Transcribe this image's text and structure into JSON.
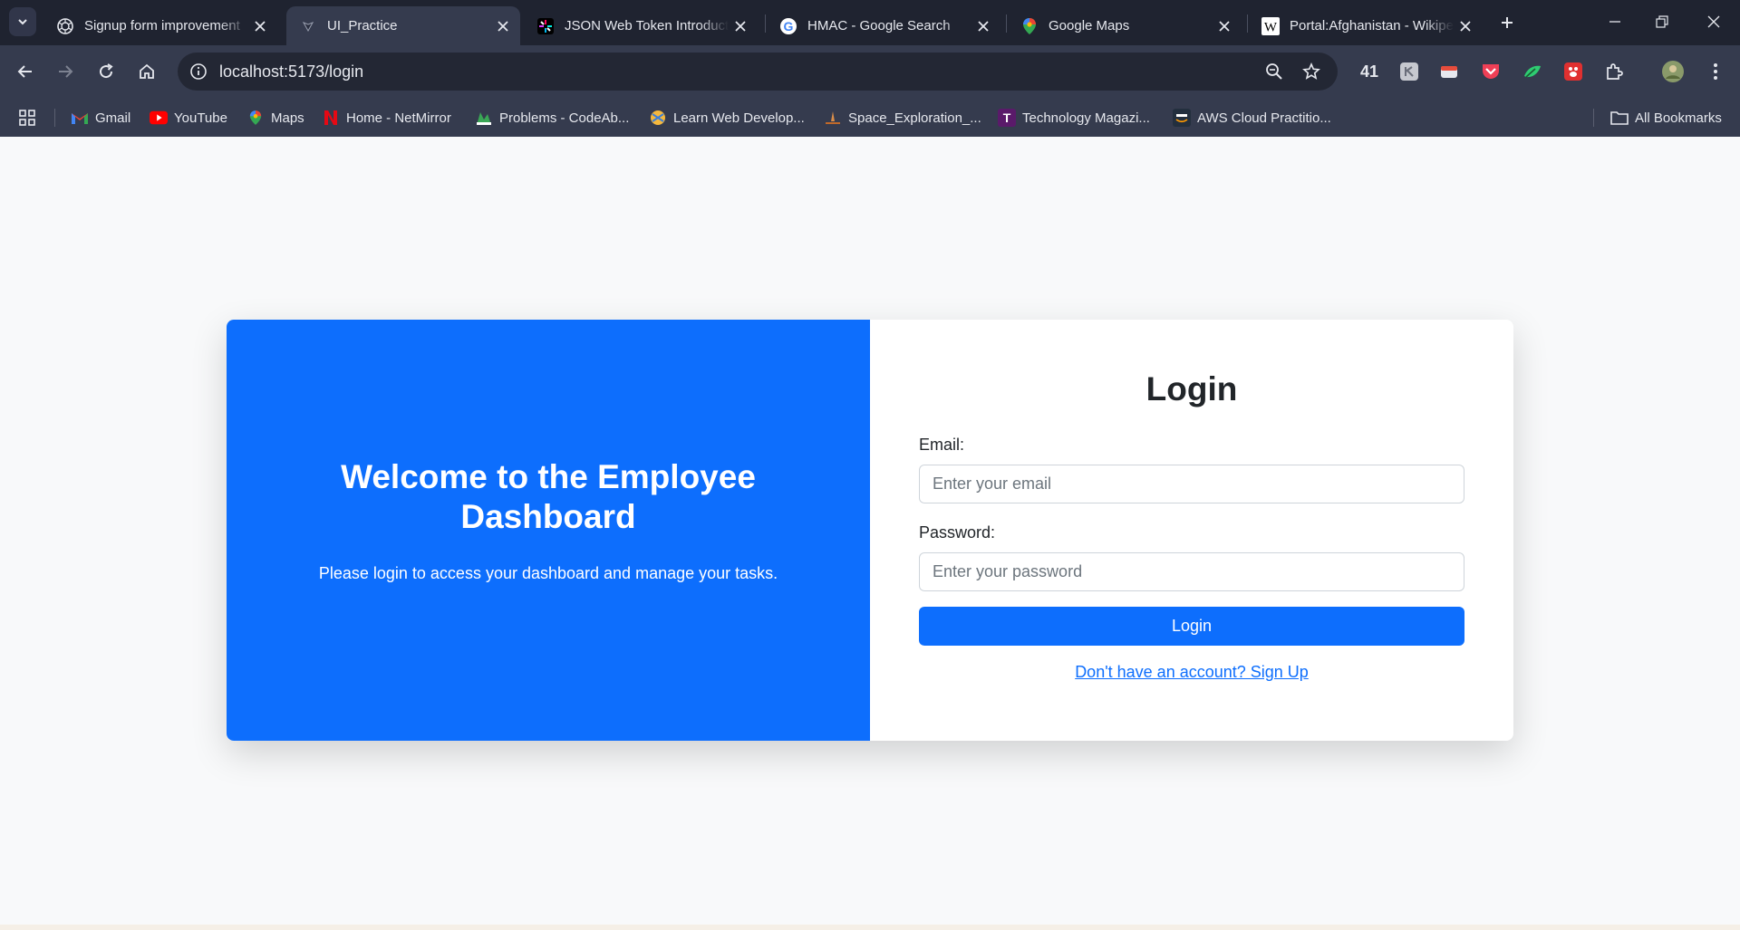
{
  "browser": {
    "tabs": [
      {
        "title": "Signup form improvement",
        "favicon": "openai-icon",
        "active": false
      },
      {
        "title": "UI_Practice",
        "favicon": "vite-icon",
        "active": true
      },
      {
        "title": "JSON Web Token Introduction",
        "favicon": "jwt-icon",
        "active": false
      },
      {
        "title": "HMAC - Google Search",
        "favicon": "google-icon",
        "active": false
      },
      {
        "title": "Google Maps",
        "favicon": "maps-pin-icon",
        "active": false
      },
      {
        "title": "Portal:Afghanistan - Wikipedia",
        "favicon": "wikipedia-icon",
        "active": false
      }
    ],
    "url": "localhost:5173/login",
    "extension_badge": "41",
    "bookmarks": [
      {
        "label": "Gmail",
        "icon": "gmail-icon"
      },
      {
        "label": "YouTube",
        "icon": "youtube-icon"
      },
      {
        "label": "Maps",
        "icon": "maps-pin-icon"
      },
      {
        "label": "Home - NetMirror",
        "icon": "netmirror-icon"
      },
      {
        "label": "Problems - CodeAb...",
        "icon": "codeabbey-icon"
      },
      {
        "label": "Learn Web Develop...",
        "icon": "learn-web-icon"
      },
      {
        "label": "Space_Exploration_...",
        "icon": "space-icon"
      },
      {
        "label": "Technology Magazi...",
        "icon": "tech-magazine-icon"
      },
      {
        "label": "AWS Cloud Practitio...",
        "icon": "aws-icon"
      }
    ],
    "all_bookmarks": "All Bookmarks"
  },
  "welcome": {
    "title": "Welcome to the Employee Dashboard",
    "subtitle": "Please login to access your dashboard and manage your tasks."
  },
  "login": {
    "title": "Login",
    "email_label": "Email:",
    "email_placeholder": "Enter your email",
    "email_value": "",
    "password_label": "Password:",
    "password_placeholder": "Enter your password",
    "password_value": "",
    "button_label": "Login",
    "signup_link": "Don't have an account? Sign Up"
  },
  "colors": {
    "primary": "#0d6efd",
    "page_bg": "#f8f9fa",
    "chrome_dark": "#1f2330",
    "chrome_toolbar": "#353b4e"
  }
}
